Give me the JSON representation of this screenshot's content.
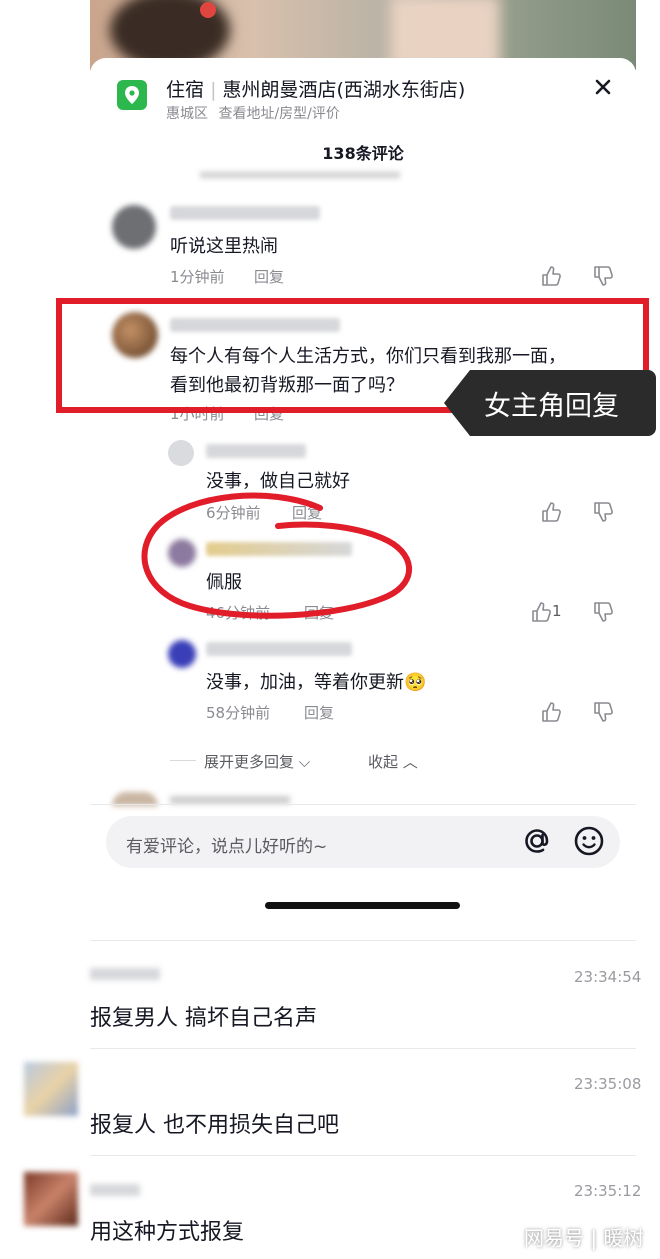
{
  "header": {
    "category": "住宿",
    "separator": "|",
    "hotel": "惠州朗曼酒店(西湖水东街店)",
    "district": "惠城区",
    "links": "查看地址/房型/评价",
    "comment_count": "138条评论"
  },
  "comments": [
    {
      "text": "听说这里热闹",
      "time": "1分钟前",
      "reply": "回复"
    },
    {
      "text_line1": "每个人有每个人生活方式，你们只看到我那一面，",
      "text_line2": "看到他最初背叛那一面了吗？",
      "time": "1小时前",
      "reply": "回复"
    }
  ],
  "replies": [
    {
      "text": "没事，做自己就好",
      "time": "6分钟前",
      "reply": "回复",
      "likes": ""
    },
    {
      "text": "佩服",
      "time": "46分钟前",
      "reply": "回复",
      "likes": "1"
    },
    {
      "text": "没事，加油，等着你更新",
      "emoji": "🥺",
      "time": "58分钟前",
      "reply": "回复",
      "likes": ""
    }
  ],
  "annotation": {
    "label": "女主角回复",
    "color": "#e11d2a"
  },
  "thread_controls": {
    "expand": "展开更多回复",
    "collapse": "收起"
  },
  "input": {
    "placeholder": "有爱评论，说点儿好听的~",
    "at_icon": "at-icon",
    "emoji_icon": "emoji-icon"
  },
  "chat": [
    {
      "time": "23:34:54",
      "text": "报复男人 搞坏自己名声"
    },
    {
      "time": "23:35:08",
      "text": "报复人 也不用损失自己吧"
    },
    {
      "time": "23:35:12",
      "text": "用这种方式报复"
    }
  ],
  "watermark": "网易号 | 暖树",
  "colors": {
    "accent_red": "#e11d2a",
    "map_icon_green": "#2db84d",
    "text": "#161823",
    "secondary": "#8a8b91"
  }
}
